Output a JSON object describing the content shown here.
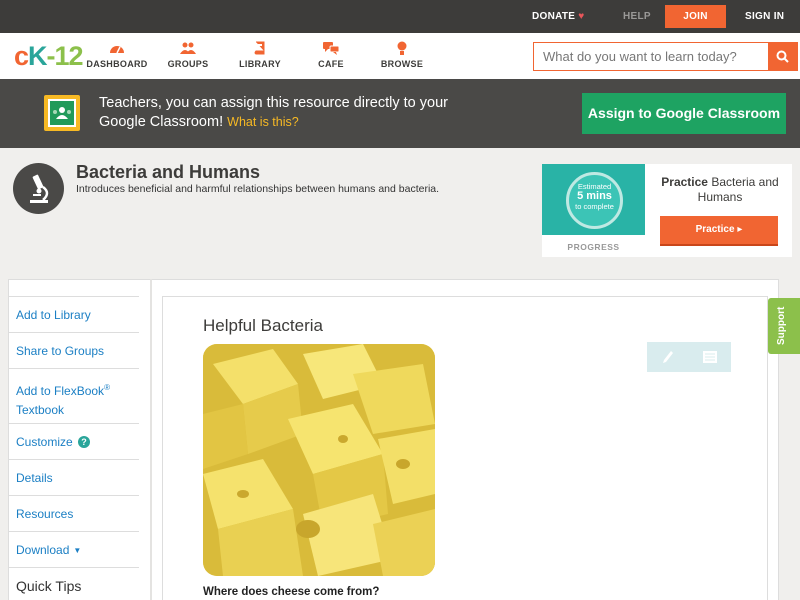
{
  "topbar": {
    "donate": "DONATE",
    "help": "HELP",
    "join": "JOIN",
    "signin": "SIGN IN"
  },
  "logo": {
    "c": "c",
    "k": "K",
    "n": "-12"
  },
  "nav": [
    {
      "label": "DASHBOARD",
      "icon": "dashboard-icon"
    },
    {
      "label": "GROUPS",
      "icon": "groups-icon"
    },
    {
      "label": "LIBRARY",
      "icon": "library-icon"
    },
    {
      "label": "CAFE",
      "icon": "cafe-icon"
    },
    {
      "label": "BROWSE",
      "icon": "browse-icon"
    }
  ],
  "search": {
    "placeholder": "What do you want to learn today?"
  },
  "banner": {
    "text": "Teachers, you can assign this resource directly to your Google Classroom!",
    "what": "What is this?",
    "button": "Assign to Google Classroom"
  },
  "concept": {
    "title": "Bacteria and Humans",
    "subtitle": "Introduces beneficial and harmful relationships between humans and bacteria."
  },
  "practice": {
    "estimated": "Estimated",
    "mins": "5 mins",
    "to_complete": "to complete",
    "progress": "PROGRESS",
    "title_bold": "Practice",
    "title_rest": "Bacteria and Humans",
    "button": "Practice"
  },
  "sidebar": {
    "items": [
      {
        "label": "Add to Library"
      },
      {
        "label": "Share to Groups"
      },
      {
        "label": "Add to FlexBook",
        "sup": "®",
        "label2": "Textbook"
      },
      {
        "label": "Customize"
      },
      {
        "label": "Details"
      },
      {
        "label": "Resources"
      },
      {
        "label": "Download"
      }
    ],
    "quick_tips": "Quick Tips"
  },
  "content": {
    "heading": "Helpful Bacteria",
    "question": "Where does cheese come from?"
  },
  "support": "Support",
  "colors": {
    "accent": "#f16532",
    "teal": "#2aa59a",
    "green": "#8cc04b",
    "classroom_green": "#1ea362"
  }
}
